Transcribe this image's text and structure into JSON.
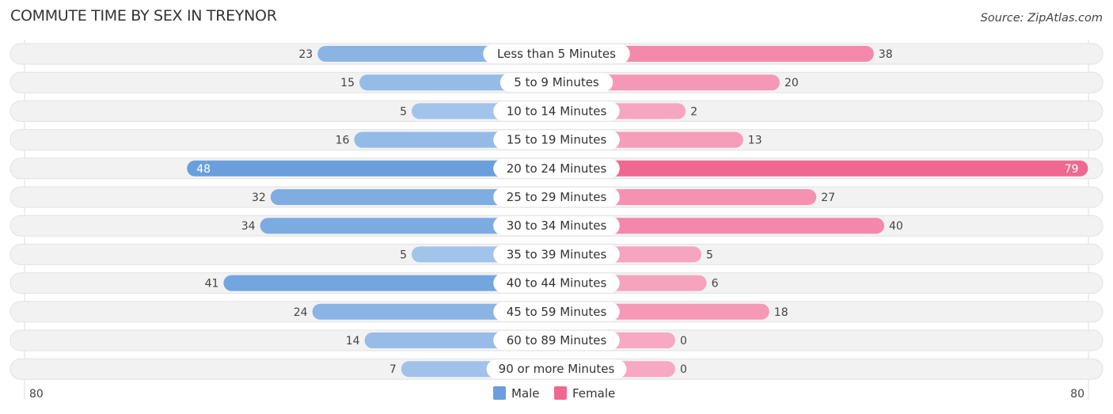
{
  "title": "COMMUTE TIME BY SEX IN TREYNOR",
  "source": "Source: ZipAtlas.com",
  "colors": {
    "male": "#6a9fdc",
    "male_light": "#a9c8ec",
    "female": "#f06892",
    "female_light": "#f7a8c2",
    "track": "#f2f2f2"
  },
  "chart_data": {
    "type": "bar",
    "orientation": "horizontal-diverging",
    "title": "COMMUTE TIME BY SEX IN TREYNOR",
    "categories": [
      "Less than 5 Minutes",
      "5 to 9 Minutes",
      "10 to 14 Minutes",
      "15 to 19 Minutes",
      "20 to 24 Minutes",
      "25 to 29 Minutes",
      "30 to 34 Minutes",
      "35 to 39 Minutes",
      "40 to 44 Minutes",
      "45 to 59 Minutes",
      "60 to 89 Minutes",
      "90 or more Minutes"
    ],
    "series": [
      {
        "name": "Male",
        "values": [
          23,
          15,
          5,
          16,
          48,
          32,
          34,
          5,
          41,
          24,
          14,
          7
        ]
      },
      {
        "name": "Female",
        "values": [
          38,
          20,
          2,
          13,
          79,
          27,
          40,
          5,
          6,
          18,
          0,
          0
        ]
      }
    ],
    "axis_min_label": "80",
    "axis_max_label": "80",
    "xlim": [
      -80,
      80
    ],
    "legend": {
      "position": "bottom-center",
      "items": [
        "Male",
        "Female"
      ]
    }
  }
}
